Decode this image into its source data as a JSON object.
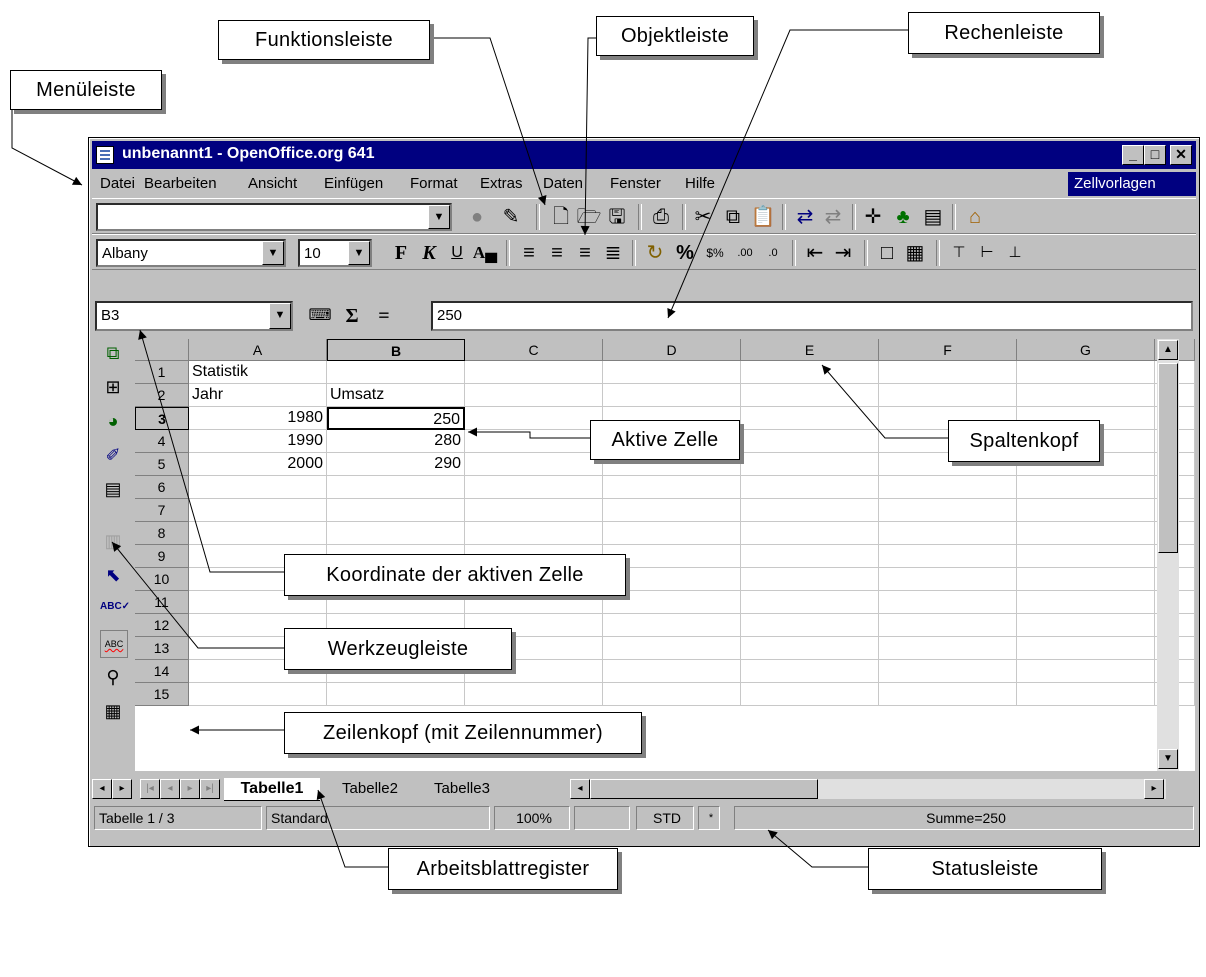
{
  "callouts": {
    "menueleiste": "Menüleiste",
    "funktionsleiste": "Funktionsleiste",
    "objektleiste": "Objektleiste",
    "rechenleiste": "Rechenleiste",
    "aktive_zelle": "Aktive Zelle",
    "spaltenkopf": "Spaltenkopf",
    "koordinate": "Koordinate der aktiven Zelle",
    "werkzeugleiste": "Werkzeugleiste",
    "zeilenkopf": "Zeilenkopf (mit Zeilennummer)",
    "arbeitsblattregister": "Arbeitsblattregister",
    "statusleiste": "Statusleiste"
  },
  "window": {
    "title": "unbenannt1 - OpenOffice.org 641",
    "minimize": "_",
    "maximize": "□",
    "close": "✕"
  },
  "menu": [
    "Datei",
    "Bearbeiten",
    "Ansicht",
    "Einfügen",
    "Format",
    "Extras",
    "Daten",
    "Fenster",
    "Hilfe"
  ],
  "style_box": "Zellvorlagen",
  "object_bar": {
    "font": "Albany",
    "size": "10"
  },
  "formula_bar": {
    "name_box": "B3",
    "function_symbol": "Σ",
    "equals_symbol": "=",
    "content": "250"
  },
  "sheet": {
    "columns": [
      "A",
      "B",
      "C",
      "D",
      "E",
      "F",
      "G"
    ],
    "rows": [
      "1",
      "2",
      "3",
      "4",
      "5",
      "6",
      "7",
      "8",
      "9",
      "10",
      "11",
      "12",
      "13",
      "14",
      "15"
    ],
    "cells": {
      "A1": "Statistik",
      "A2": "Jahr",
      "B2": "Umsatz",
      "A3": "1980",
      "B3": "250",
      "A4": "1990",
      "B4": "280",
      "A5": "2000",
      "B5": "290"
    }
  },
  "tabs": [
    "Tabelle1",
    "Tabelle2",
    "Tabelle3"
  ],
  "statusbar": {
    "sheet": "Tabelle 1 / 3",
    "style": "Standard",
    "zoom": "100%",
    "mode": "STD",
    "modified": "*",
    "sum": "Summe=250"
  }
}
